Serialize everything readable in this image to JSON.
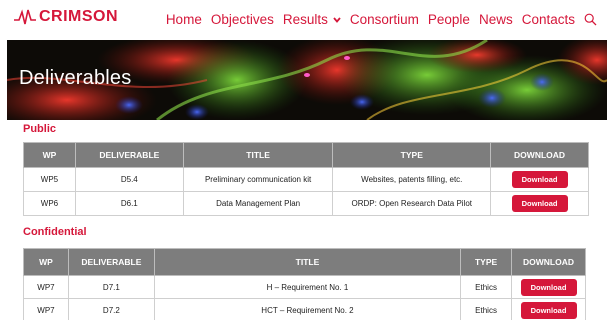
{
  "header": {
    "brand": "CRIMSON",
    "nav": [
      {
        "label": "Home"
      },
      {
        "label": "Objectives"
      },
      {
        "label": "Results"
      },
      {
        "label": "Consortium"
      },
      {
        "label": "People"
      },
      {
        "label": "News"
      },
      {
        "label": "Contacts"
      }
    ],
    "icons": {
      "logo": "heartbeat-logo-icon",
      "dropdown": "chevron-down-icon",
      "search": "search-icon"
    }
  },
  "banner": {
    "title": "Deliverables"
  },
  "colors": {
    "accent": "#d5173a",
    "table_header": "#7d7d7d"
  },
  "public": {
    "heading": "Public",
    "columns": [
      "WP",
      "DELIVERABLE",
      "TITLE",
      "TYPE",
      "DOWNLOAD"
    ],
    "rows": [
      {
        "wp": "WP5",
        "deliverable": "D5.4",
        "title": "Preliminary communication kit",
        "type": "Websites, patents filling, etc.",
        "download": "Download"
      },
      {
        "wp": "WP6",
        "deliverable": "D6.1",
        "title": "Data Management Plan",
        "type": "ORDP: Open Research Data Pilot",
        "download": "Download"
      }
    ]
  },
  "confidential": {
    "heading": "Confidential",
    "columns": [
      "WP",
      "DELIVERABLE",
      "TITLE",
      "TYPE",
      "DOWNLOAD"
    ],
    "rows": [
      {
        "wp": "WP7",
        "deliverable": "D7.1",
        "title": "H – Requirement No. 1",
        "type": "Ethics",
        "download": "Download"
      },
      {
        "wp": "WP7",
        "deliverable": "D7.2",
        "title": "HCT – Requirement No. 2",
        "type": "Ethics",
        "download": "Download"
      }
    ]
  }
}
